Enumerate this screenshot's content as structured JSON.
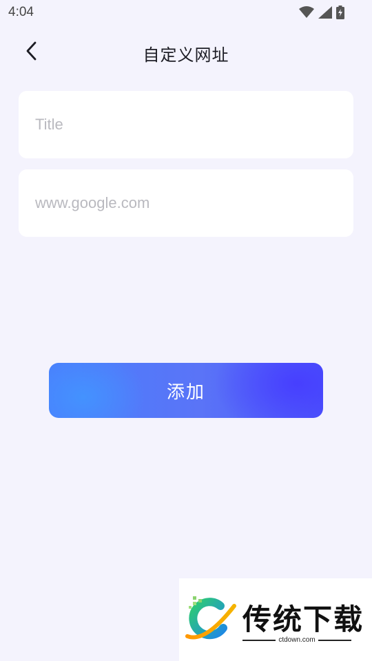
{
  "status_bar": {
    "time": "4:04",
    "icons": [
      "wifi-icon",
      "cellular-signal-icon",
      "battery-charging-icon"
    ]
  },
  "app_bar": {
    "back_icon": "chevron-left-icon",
    "title": "自定义网址"
  },
  "form": {
    "title_field": {
      "value": "",
      "placeholder": "Title"
    },
    "url_field": {
      "value": "",
      "placeholder": "www.google.com"
    },
    "add_button_label": "添加"
  },
  "watermark": {
    "brand": "传统下载",
    "url": "ctdown.com"
  },
  "colors": {
    "background": "#f4f3fd",
    "field_background": "#ffffff",
    "placeholder": "#b9b9bf",
    "button_start": "#4a7ffd",
    "button_end": "#4c55fb"
  }
}
